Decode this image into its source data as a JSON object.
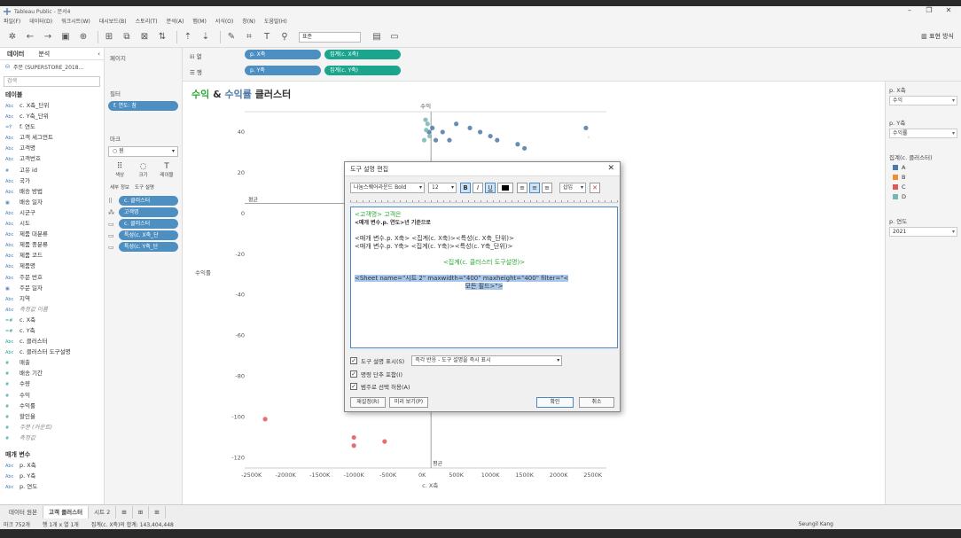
{
  "app": {
    "title": "Tableau Public - 문서4"
  },
  "menu": [
    "파일(F)",
    "데이터(D)",
    "워크시트(W)",
    "대시보드(B)",
    "스토리(T)",
    "분석(A)",
    "맵(M)",
    "서식(O)",
    "창(N)",
    "도움말(H)"
  ],
  "toolbar": {
    "fit_select": "표준",
    "present_label": "표현 방식"
  },
  "data_pane": {
    "tabs": [
      "데이터",
      "분석"
    ],
    "datasource": "주문 (SUPERSTORE_2018...",
    "search_placeholder": "검색",
    "tables_header": "테이블",
    "fields": [
      {
        "type": "Abc",
        "name": "c. X축_단위",
        "m": false,
        "i": false
      },
      {
        "type": "Abc",
        "name": "c. Y축_단위",
        "m": false,
        "i": false
      },
      {
        "type": "=Ŷ",
        "name": "f. 연도",
        "m": false,
        "i": false
      },
      {
        "type": "Abc",
        "name": "고객 세그먼트",
        "m": false,
        "i": false
      },
      {
        "type": "Abc",
        "name": "고객명",
        "m": false,
        "i": false
      },
      {
        "type": "Abc",
        "name": "고객번호",
        "m": false,
        "i": false
      },
      {
        "type": "#",
        "name": "고유 id",
        "m": false,
        "i": false
      },
      {
        "type": "Abc",
        "name": "국가",
        "m": false,
        "i": false
      },
      {
        "type": "Abc",
        "name": "배송 방법",
        "m": false,
        "i": false
      },
      {
        "type": "▣",
        "name": "배송 일자",
        "m": false,
        "i": false
      },
      {
        "type": "Abc",
        "name": "시군구",
        "m": false,
        "i": false
      },
      {
        "type": "Abc",
        "name": "시도",
        "m": false,
        "i": false
      },
      {
        "type": "Abc",
        "name": "제품 대분류",
        "m": false,
        "i": false
      },
      {
        "type": "Abc",
        "name": "제품 중분류",
        "m": false,
        "i": false
      },
      {
        "type": "Abc",
        "name": "제품 코드",
        "m": false,
        "i": false
      },
      {
        "type": "Abc",
        "name": "제품명",
        "m": false,
        "i": false
      },
      {
        "type": "Abc",
        "name": "주문 번호",
        "m": false,
        "i": false
      },
      {
        "type": "▣",
        "name": "주문 일자",
        "m": false,
        "i": false
      },
      {
        "type": "Abc",
        "name": "지역",
        "m": false,
        "i": false
      },
      {
        "type": "Abc",
        "name": "측정값 이름",
        "m": false,
        "i": true
      },
      {
        "type": "=#",
        "name": "c. X축",
        "m": true,
        "i": false
      },
      {
        "type": "=#",
        "name": "c. Y축",
        "m": true,
        "i": false
      },
      {
        "type": "Abc",
        "name": "c. 클러스터",
        "m": true,
        "i": false
      },
      {
        "type": "Abc",
        "name": "c. 클러스터 도구설명",
        "m": true,
        "i": false
      },
      {
        "type": "#",
        "name": "매출",
        "m": true,
        "i": false
      },
      {
        "type": "#",
        "name": "배송 기간",
        "m": true,
        "i": false
      },
      {
        "type": "#",
        "name": "수량",
        "m": true,
        "i": false
      },
      {
        "type": "#",
        "name": "수익",
        "m": true,
        "i": false
      },
      {
        "type": "#",
        "name": "수익률",
        "m": true,
        "i": false
      },
      {
        "type": "#",
        "name": "할인율",
        "m": true,
        "i": false
      },
      {
        "type": "#",
        "name": "주문 (카운트)",
        "m": true,
        "i": true
      },
      {
        "type": "#",
        "name": "측정값",
        "m": true,
        "i": true
      }
    ],
    "params_header": "매개 변수",
    "params": [
      {
        "type": "Abc",
        "name": "p. X축"
      },
      {
        "type": "Abc",
        "name": "p. Y축"
      },
      {
        "type": "Abc",
        "name": "p. 연도"
      }
    ]
  },
  "cards": {
    "pages": "페이지",
    "filters": "필터",
    "filter_pill": "f. 연도: 참",
    "marks": "마크",
    "mark_type": "원",
    "mark_buttons": [
      {
        "icon": "⠿",
        "label": "색상"
      },
      {
        "icon": "◌",
        "label": "크기"
      },
      {
        "icon": "T",
        "label": "레이블"
      }
    ],
    "detail": "세부 정보",
    "tooltip": "도구 설명",
    "mark_pills": [
      {
        "icon": "⠿",
        "label": "c. 클러스터",
        "color": "blue"
      },
      {
        "icon": "⁂",
        "label": "고객명",
        "color": "blue"
      },
      {
        "icon": "▭",
        "label": "c. 클러스터",
        "color": "blue"
      },
      {
        "icon": "▭",
        "label": "특성(c. X축_단",
        "color": "blue"
      },
      {
        "icon": "▭",
        "label": "특성(c. Y축_단",
        "color": "blue"
      }
    ]
  },
  "shelves": {
    "columns_label": "열",
    "rows_label": "행",
    "columns": [
      {
        "label": "p. X축",
        "color": "blue"
      },
      {
        "label": "집계(c. X축)",
        "color": "green"
      }
    ],
    "rows": [
      {
        "label": "p. Y축",
        "color": "blue"
      },
      {
        "label": "집계(c. Y축)",
        "color": "green"
      }
    ]
  },
  "viz": {
    "title_a": "수익",
    "title_amp": " & ",
    "title_b": "수익률",
    "title_c": " 클러스터"
  },
  "legend": {
    "px_label": "p. X축",
    "px_value": "수익",
    "py_label": "p. Y축",
    "py_value": "수익률",
    "cluster_label": "집계(c. 클러스터)",
    "clusters": [
      {
        "name": "A",
        "color": "#4e79a7"
      },
      {
        "name": "B",
        "color": "#f28e2b"
      },
      {
        "name": "C",
        "color": "#e15759"
      },
      {
        "name": "D",
        "color": "#76b7b2"
      }
    ],
    "year_label": "p. 연도",
    "year_value": "2021"
  },
  "bottom": {
    "tabs": [
      {
        "label": "데이터 원본",
        "active": false
      },
      {
        "label": "고객 클러스터",
        "active": true
      },
      {
        "label": "시트 2",
        "active": false
      }
    ],
    "status": [
      "마크 752개",
      "행 1개 x 열 1개",
      "집계(c. X축)의 합계: 143,404,448"
    ],
    "user": "Seungil Kang"
  },
  "dialog": {
    "title": "도구 설명 편집",
    "font": "나눔스퀘어라운드 Bold",
    "size": "12",
    "insert": "삽입",
    "lines": [
      {
        "text": "<고객명> 고객은",
        "cls": "grn"
      },
      {
        "text": "<매개 변수.p. 연도>년 기준으로",
        "cls": "small"
      },
      {
        "text": "",
        "cls": ""
      },
      {
        "text": "<매개 변수.p. X축> <집계(c. X축)><특성(c. X축_단위)>",
        "cls": ""
      },
      {
        "text": "<매개 변수.p. Y축> <집계(c. Y축)><특성(c. Y축_단위)>",
        "cls": ""
      },
      {
        "text": "",
        "cls": ""
      },
      {
        "text": "<집계(c. 클러스터 도구설명)>",
        "cls": "grn center"
      },
      {
        "text": "",
        "cls": ""
      },
      {
        "text": "<Sheet name=\"시트 2\" maxwidth=\"400\" maxheight=\"400\" filter=\"<",
        "cls": "hl"
      },
      {
        "text": "모든 필드>\">",
        "cls": "hl center"
      }
    ],
    "show_tooltip_label": "도구 설명 표시(S)",
    "show_mode": "즉각 반응 - 도구 설명을 즉시 표시",
    "command_label": "명령 단추 포함(I)",
    "category_label": "범주로 선택 허용(A)",
    "reset": "재설정(R)",
    "preview": "미리 보기(P)",
    "ok": "확인",
    "cancel": "취소"
  },
  "chart_data": {
    "type": "scatter",
    "title": "수익 & 수익률 클러스터",
    "xlabel": "c. X축",
    "ylabel": "수익률",
    "top_label": "수익",
    "x_ticks": [
      "-2500K",
      "-2000K",
      "-1500K",
      "-1000K",
      "-500K",
      "0K",
      "500K",
      "1000K",
      "1500K",
      "2000K",
      "2500K"
    ],
    "y_ticks": [
      "40",
      "20",
      "0",
      "-20",
      "-40",
      "-60",
      "-80",
      "-100",
      "-120"
    ],
    "xlim": [
      -2600000,
      2700000
    ],
    "ylim": [
      -125,
      50
    ],
    "ref_labels": [
      "평균",
      "평균",
      "평균",
      "평균"
    ],
    "series": [
      {
        "cluster": "A",
        "color": "#4e79a7",
        "points": [
          [
            100000,
            40
          ],
          [
            150000,
            42
          ],
          [
            300000,
            40
          ],
          [
            500000,
            44
          ],
          [
            700000,
            42
          ],
          [
            850000,
            40
          ],
          [
            1000000,
            38
          ],
          [
            1100000,
            36
          ],
          [
            1400000,
            34
          ],
          [
            1500000,
            32
          ],
          [
            2400000,
            42
          ],
          [
            200000,
            36
          ],
          [
            400000,
            36
          ]
        ]
      },
      {
        "cluster": "C",
        "color": "#e15759",
        "points": [
          [
            -2300000,
            -101
          ],
          [
            -1000000,
            -110
          ],
          [
            -1000000,
            -114
          ],
          [
            -550000,
            -112
          ]
        ]
      },
      {
        "cluster": "D",
        "color": "#76b7b2",
        "points": [
          [
            50000,
            46
          ],
          [
            80000,
            44
          ],
          [
            60000,
            41
          ],
          [
            110000,
            38
          ],
          [
            30000,
            36
          ]
        ]
      }
    ]
  }
}
